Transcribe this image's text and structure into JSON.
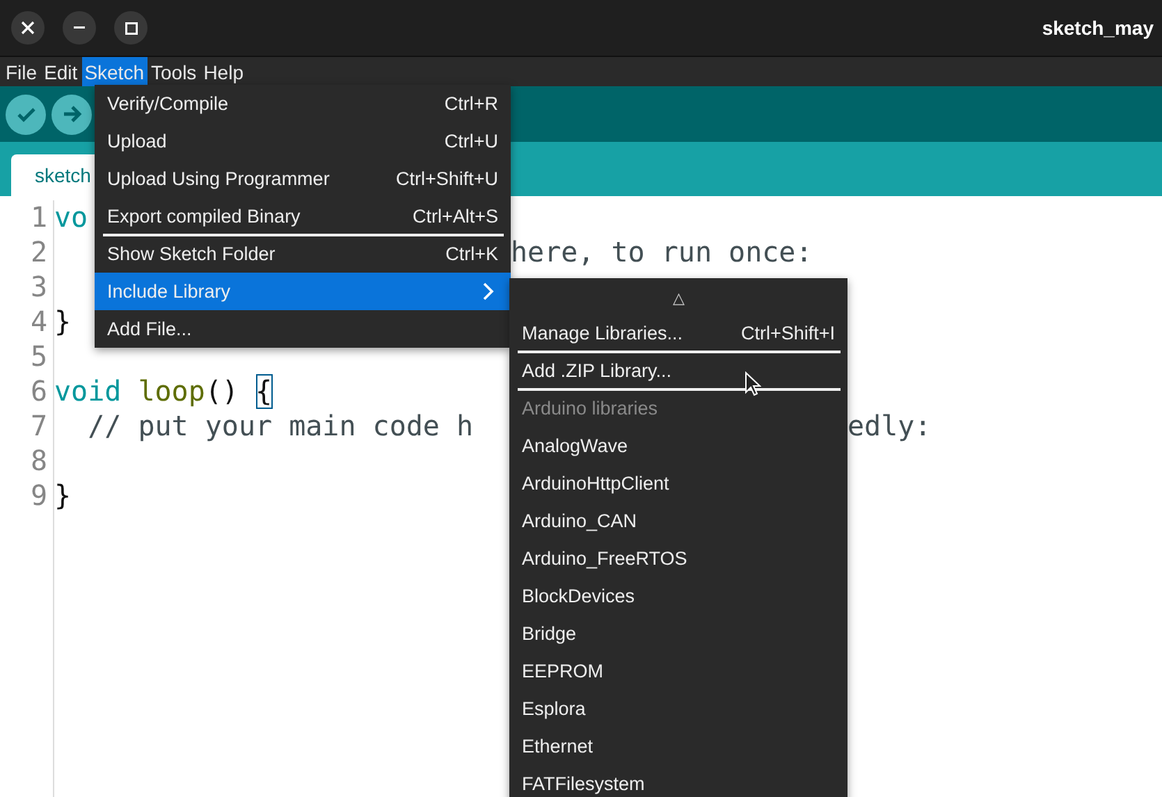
{
  "window": {
    "title": "sketch_may"
  },
  "menubar": [
    {
      "label": "File",
      "selected": false
    },
    {
      "label": "Edit",
      "selected": false
    },
    {
      "label": "Sketch",
      "selected": true
    },
    {
      "label": "Tools",
      "selected": false
    },
    {
      "label": "Help",
      "selected": false
    }
  ],
  "tab": {
    "label": "sketch"
  },
  "editor": {
    "lines": [
      {
        "number": "1",
        "segments": [
          {
            "text": "vo",
            "kind": "keyword"
          }
        ]
      },
      {
        "number": "2",
        "segments": [
          {
            "text": "here, to run once:",
            "kind": "aftermenu"
          }
        ]
      },
      {
        "number": "3"
      },
      {
        "number": "4",
        "segments": [
          {
            "text": "}",
            "kind": "plain"
          }
        ]
      },
      {
        "number": "5"
      },
      {
        "number": "6",
        "segments": [
          {
            "text": "void",
            "kind": "keyword"
          },
          {
            "text": " loop",
            "kind": "function"
          },
          {
            "text": "() ",
            "kind": "plain"
          },
          {
            "text": "{",
            "kind": "cursor"
          }
        ]
      },
      {
        "number": "7",
        "segments": [
          {
            "text": "  // put your main code h",
            "kind": "comment"
          },
          {
            "text": "edly:",
            "kind": "aftersubmenu"
          }
        ]
      },
      {
        "number": "8"
      },
      {
        "number": "9",
        "segments": [
          {
            "text": "}",
            "kind": "plain"
          }
        ]
      }
    ]
  },
  "sketch_menu": {
    "items": [
      {
        "label": "Verify/Compile",
        "shortcut": "Ctrl+R",
        "selected": false,
        "separator_after": false,
        "submenu": false
      },
      {
        "label": "Upload",
        "shortcut": "Ctrl+U",
        "selected": false,
        "separator_after": false,
        "submenu": false
      },
      {
        "label": "Upload Using Programmer",
        "shortcut": "Ctrl+Shift+U",
        "selected": false,
        "separator_after": false,
        "submenu": false
      },
      {
        "label": "Export compiled Binary",
        "shortcut": "Ctrl+Alt+S",
        "selected": false,
        "separator_after": true,
        "submenu": false
      },
      {
        "label": "Show Sketch Folder",
        "shortcut": "Ctrl+K",
        "selected": false,
        "separator_after": false,
        "submenu": false
      },
      {
        "label": "Include Library",
        "selected": true,
        "separator_after": false,
        "submenu": true
      },
      {
        "label": "Add File...",
        "selected": false,
        "separator_after": false,
        "submenu": false
      }
    ]
  },
  "library_submenu": {
    "scroll_up": "△",
    "items": [
      {
        "label": "Manage Libraries...",
        "shortcut": "Ctrl+Shift+I",
        "kind": "item",
        "separator_after": true
      },
      {
        "label": "Add .ZIP Library...",
        "kind": "item",
        "separator_after": true
      },
      {
        "label": "Arduino libraries",
        "kind": "header",
        "separator_after": false
      },
      {
        "label": "AnalogWave",
        "kind": "item",
        "separator_after": false
      },
      {
        "label": "ArduinoHttpClient",
        "kind": "item",
        "separator_after": false
      },
      {
        "label": "Arduino_CAN",
        "kind": "item",
        "separator_after": false
      },
      {
        "label": "Arduino_FreeRTOS",
        "kind": "item",
        "separator_after": false
      },
      {
        "label": "BlockDevices",
        "kind": "item",
        "separator_after": false
      },
      {
        "label": "Bridge",
        "kind": "item",
        "separator_after": false
      },
      {
        "label": "EEPROM",
        "kind": "item",
        "separator_after": false
      },
      {
        "label": "Esplora",
        "kind": "item",
        "separator_after": false
      },
      {
        "label": "Ethernet",
        "kind": "item",
        "separator_after": false
      },
      {
        "label": "FATFilesystem",
        "kind": "item",
        "separator_after": false
      }
    ]
  }
}
